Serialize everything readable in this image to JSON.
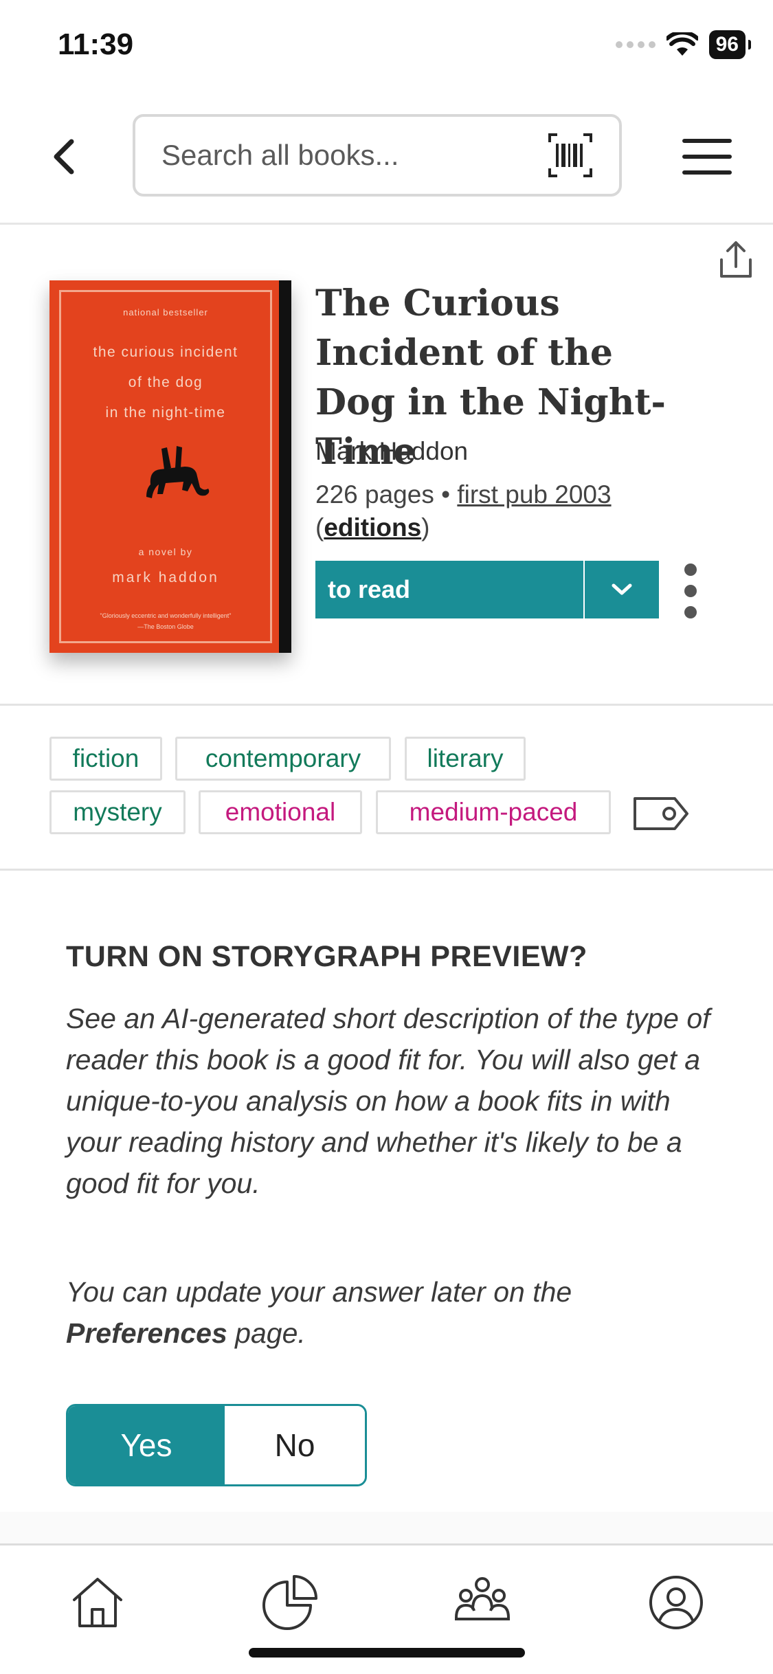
{
  "status_bar": {
    "time": "11:39",
    "battery": "96"
  },
  "search": {
    "placeholder": "Search all books..."
  },
  "book": {
    "cover": {
      "top_line": "national bestseller",
      "title_line1": "the curious incident",
      "title_line2": "of the dog",
      "title_line3": "in the night-time",
      "byline": "a novel by",
      "author": "mark haddon",
      "quote": "\"Gloriously eccentric and wonderfully intelligent\"",
      "quote_source": "—The Boston Globe"
    },
    "title": "The Curious Incident of the Dog in the Night-Time",
    "author": "Mark Haddon",
    "pages": "226 pages",
    "separator": "•",
    "first_pub": "first pub 2003",
    "editions_open": "(",
    "editions": "editions",
    "editions_close": ")",
    "status_button": "to read"
  },
  "tags": [
    {
      "label": "fiction",
      "color": "#127a5a"
    },
    {
      "label": "contemporary",
      "color": "#127a5a"
    },
    {
      "label": "literary",
      "color": "#127a5a"
    },
    {
      "label": "mystery",
      "color": "#127a5a"
    },
    {
      "label": "emotional",
      "color": "#c4197e"
    },
    {
      "label": "medium-paced",
      "color": "#c4197e"
    }
  ],
  "preview": {
    "heading": "TURN ON STORYGRAPH PREVIEW?",
    "body": "See an AI-generated short description of the type of reader this book is a good fit for. You will also get a unique-to-you analysis on how a book fits in with your reading history and whether it's likely to be a good fit for you.",
    "note_prefix": "You can update your answer later on the ",
    "note_bold": "Preferences",
    "note_suffix": " page.",
    "yes": "Yes",
    "no": "No"
  },
  "colors": {
    "accent": "#1a8e96",
    "tag_green": "#127a5a",
    "tag_pink": "#c4197e",
    "cover": "#e3431e"
  },
  "icons": [
    "back-icon",
    "barcode-icon",
    "hamburger-menu-icon",
    "share-icon",
    "chevron-down-icon",
    "more-vertical-icon",
    "tag-icon",
    "home-icon",
    "stats-icon",
    "community-icon",
    "profile-icon"
  ]
}
